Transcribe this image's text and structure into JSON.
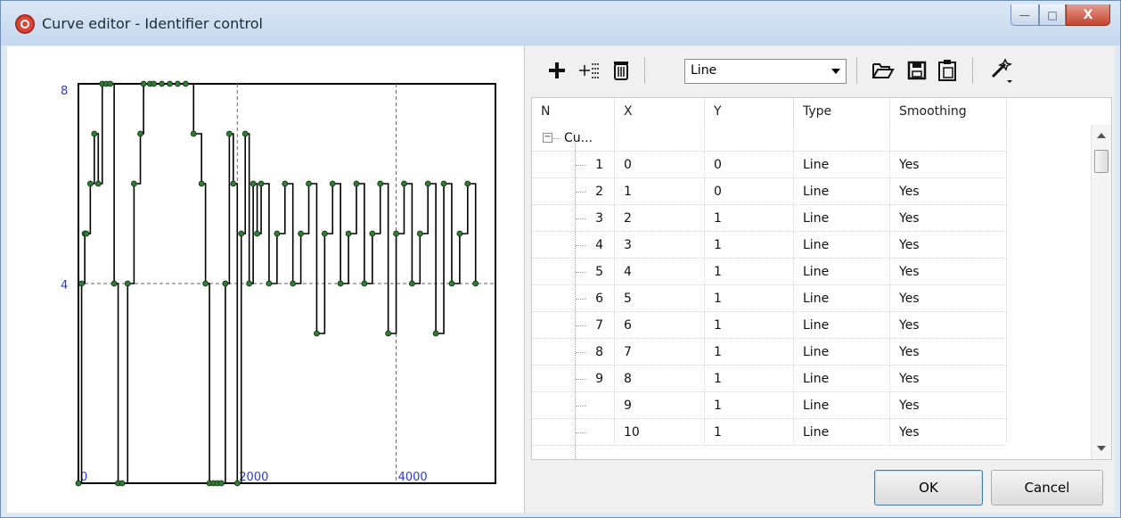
{
  "window": {
    "title": "Curve editor - Identifier control",
    "min_glyph": "—",
    "max_glyph": "□",
    "close_glyph": "X"
  },
  "toolbar": {
    "add_icon": "plus-icon",
    "insert_icon": "insert-row-icon",
    "delete_icon": "trash-icon",
    "type_select_value": "Line",
    "open_icon": "folder-open-icon",
    "save_icon": "save-icon",
    "paste_icon": "clipboard-icon",
    "tools_icon": "wand-icon"
  },
  "table": {
    "headers": [
      "N",
      "X",
      "Y",
      "Type",
      "Smoothing"
    ],
    "group_label": "Cu...",
    "rows": [
      {
        "n": "1",
        "x": "0",
        "y": "0",
        "type": "Line",
        "smoothing": "Yes"
      },
      {
        "n": "2",
        "x": "1",
        "y": "0",
        "type": "Line",
        "smoothing": "Yes"
      },
      {
        "n": "3",
        "x": "2",
        "y": "1",
        "type": "Line",
        "smoothing": "Yes"
      },
      {
        "n": "4",
        "x": "3",
        "y": "1",
        "type": "Line",
        "smoothing": "Yes"
      },
      {
        "n": "5",
        "x": "4",
        "y": "1",
        "type": "Line",
        "smoothing": "Yes"
      },
      {
        "n": "6",
        "x": "5",
        "y": "1",
        "type": "Line",
        "smoothing": "Yes"
      },
      {
        "n": "7",
        "x": "6",
        "y": "1",
        "type": "Line",
        "smoothing": "Yes"
      },
      {
        "n": "8",
        "x": "7",
        "y": "1",
        "type": "Line",
        "smoothing": "Yes"
      },
      {
        "n": "9",
        "x": "8",
        "y": "1",
        "type": "Line",
        "smoothing": "Yes"
      },
      {
        "n": "",
        "x": "9",
        "y": "1",
        "type": "Line",
        "smoothing": "Yes"
      },
      {
        "n": "",
        "x": "10",
        "y": "1",
        "type": "Line",
        "smoothing": "Yes"
      }
    ]
  },
  "buttons": {
    "ok": "OK",
    "cancel": "Cancel"
  },
  "chart_data": {
    "type": "line",
    "title": "",
    "xlabel": "",
    "ylabel": "",
    "xlim": [
      0,
      5250
    ],
    "ylim": [
      0,
      8
    ],
    "x_ticks": [
      "0",
      "2000",
      "4000"
    ],
    "y_ticks": [
      "0",
      "4",
      "8"
    ],
    "grid": "dashed lines at x=2000, x=4000 and y=4",
    "series": [
      {
        "color": "#000000",
        "marker_color": "#2e7d32",
        "x": [
          0,
          40,
          80,
          100,
          150,
          200,
          250,
          300,
          350,
          400,
          450,
          500,
          550,
          620,
          700,
          780,
          820,
          900,
          950,
          1050,
          1150,
          1250,
          1350,
          1450,
          1550,
          1600,
          1650,
          1700,
          1750,
          1800,
          1850,
          1900,
          1950,
          2000,
          2050,
          2100,
          2150,
          2200,
          2250,
          2300,
          2400,
          2500,
          2600,
          2700,
          2800,
          2900,
          3000,
          3100,
          3200,
          3300,
          3400,
          3500,
          3600,
          3700,
          3800,
          3900,
          4000,
          4100,
          4200,
          4300,
          4400,
          4500,
          4600,
          4700,
          4800,
          4900,
          5000
        ],
        "y": [
          0,
          4,
          5,
          5,
          6,
          7,
          6,
          8,
          8,
          8,
          4,
          0,
          0,
          4,
          6,
          7,
          8,
          8,
          8,
          8,
          8,
          8,
          8,
          7,
          6,
          4,
          0,
          0,
          0,
          0,
          4,
          7,
          6,
          0,
          5,
          7,
          4,
          6,
          5,
          6,
          4,
          5,
          6,
          4,
          5,
          6,
          3,
          5,
          6,
          4,
          5,
          6,
          4,
          5,
          6,
          3,
          5,
          6,
          4,
          5,
          6,
          3,
          6,
          4,
          5,
          6,
          4
        ]
      }
    ]
  }
}
